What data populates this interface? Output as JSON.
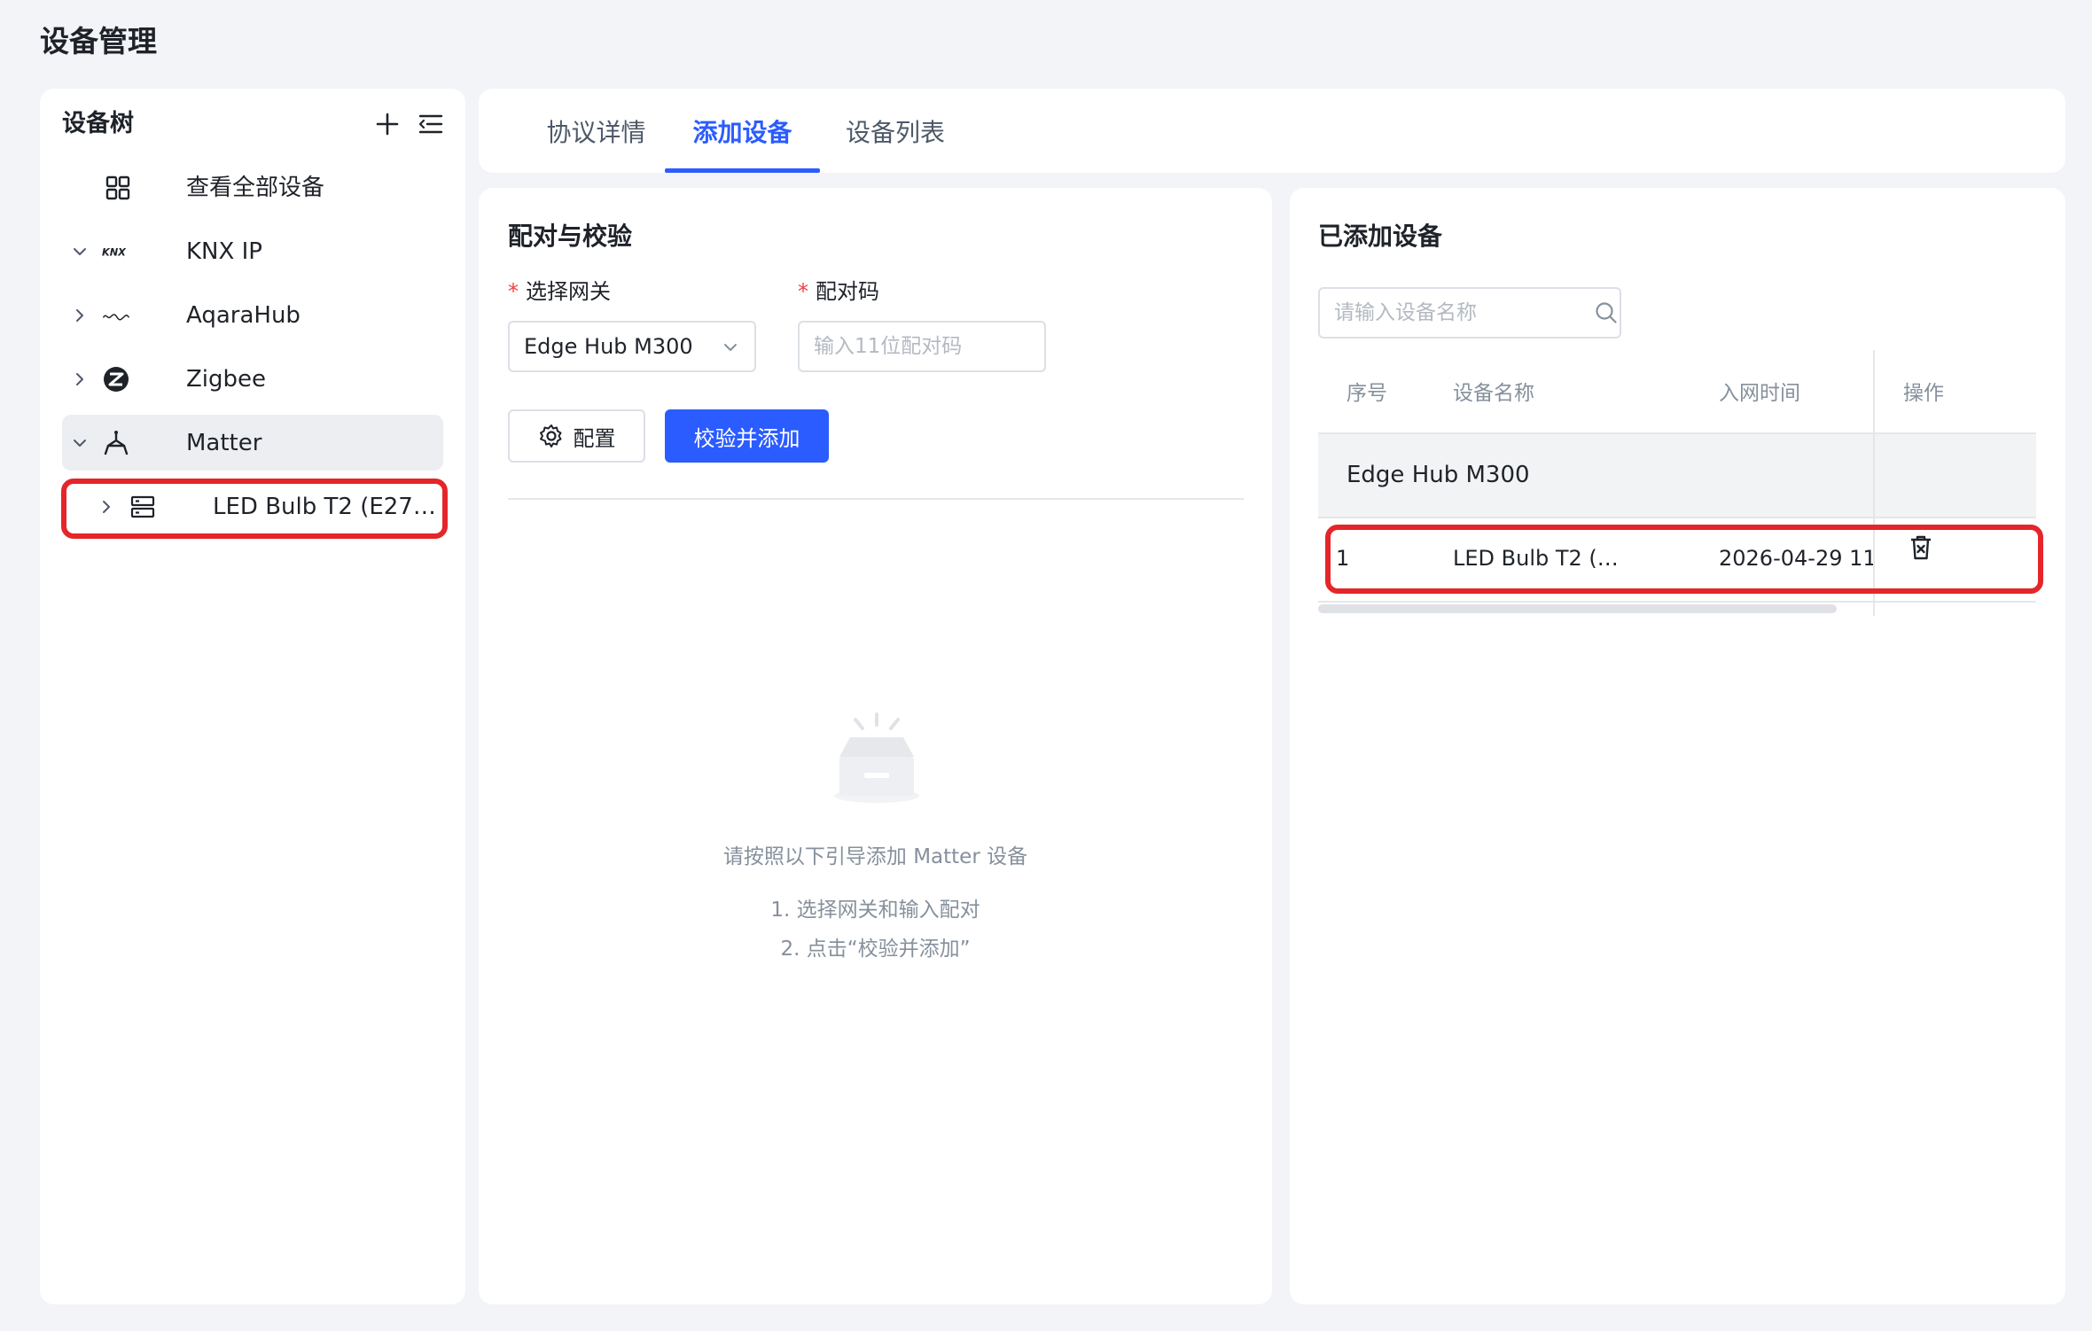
{
  "page": {
    "title": "设备管理"
  },
  "sidebar": {
    "title": "设备树",
    "view_all": "查看全部设备",
    "protocols": [
      {
        "label": "KNX IP",
        "expanded": true
      },
      {
        "label": "AqaraHub",
        "expanded": false
      },
      {
        "label": "Zigbee",
        "expanded": false
      },
      {
        "label": "Matter",
        "expanded": true,
        "active": true
      }
    ],
    "child_device": "LED Bulb T2 (E27…"
  },
  "tabs": [
    {
      "label": "协议详情",
      "active": false
    },
    {
      "label": "添加设备",
      "active": true
    },
    {
      "label": "设备列表",
      "active": false
    }
  ],
  "pair": {
    "title": "配对与校验",
    "gateway_label": "选择网关",
    "gateway_value": "Edge Hub M300",
    "code_label": "配对码",
    "code_placeholder": "输入11位配对码",
    "config_button": "配置",
    "submit_button": "校验并添加",
    "guide_title": "请按照以下引导添加 Matter 设备",
    "guide_step1": "1. 选择网关和输入配对",
    "guide_step2": "2. 点击“校验并添加”"
  },
  "added": {
    "title": "已添加设备",
    "search_placeholder": "请输入设备名称",
    "columns": [
      "序号",
      "设备名称",
      "入网时间",
      "操作"
    ],
    "group": "Edge Hub M300",
    "rows": [
      {
        "index": "1",
        "name": "LED Bulb T2 (…",
        "time": "2026-04-29 11"
      }
    ]
  },
  "colors": {
    "primary": "#2b5cff",
    "highlight": "#e4262a",
    "background": "#f3f4f7"
  }
}
